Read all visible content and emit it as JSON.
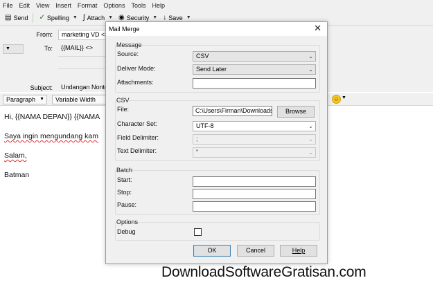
{
  "menubar": {
    "items": [
      "File",
      "Edit",
      "View",
      "Insert",
      "Format",
      "Options",
      "Tools",
      "Help"
    ]
  },
  "toolbar": {
    "send": "Send",
    "spelling": "Spelling",
    "attach": "Attach",
    "security": "Security",
    "save": "Save"
  },
  "header": {
    "from_label": "From:",
    "from_value": "marketing VD <s",
    "to_label": "To:",
    "to_value": "{{MAIL}} <>",
    "subject_label": "Subject:",
    "subject_value": "Undangan Nonto"
  },
  "format_bar": {
    "paragraph": "Paragraph",
    "variable_width": "Variable Width"
  },
  "body": {
    "line1": "Hi, {{NAMA DEPAN}} {{NAMA",
    "line2": "Saya ingin mengundang kam",
    "line3": "Salam,",
    "line4": "Batman"
  },
  "watermark": "DownloadSoftwareGratisan.com",
  "dialog": {
    "title": "Mail Merge",
    "message_group": "Message",
    "source_label": "Source:",
    "source_value": "CSV",
    "deliver_label": "Deliver Mode:",
    "deliver_value": "Send Later",
    "attachments_label": "Attachments:",
    "attachments_value": "",
    "csv_group": "CSV",
    "file_label": "File:",
    "file_value": "C:\\Users\\Firman\\Downloads",
    "browse": "Browse",
    "charset_label": "Character Set:",
    "charset_value": "UTF-8",
    "field_delim_label": "Field Delimiter:",
    "field_delim_value": ";",
    "text_delim_label": "Text Delimiter:",
    "text_delim_value": "\"",
    "batch_group": "Batch",
    "start_label": "Start:",
    "stop_label": "Stop:",
    "pause_label": "Pause:",
    "options_group": "Options",
    "debug_label": "Debug",
    "debug_checked": false,
    "ok": "OK",
    "cancel": "Cancel",
    "help": "Help"
  }
}
